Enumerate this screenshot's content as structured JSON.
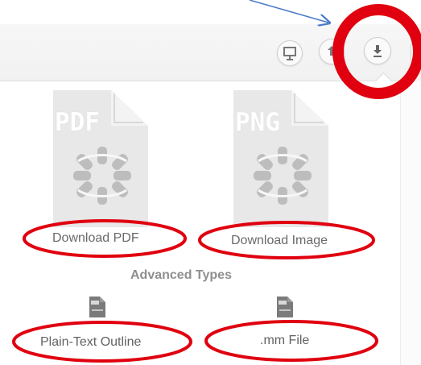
{
  "toolbar": {
    "present_icon": "presentation-icon",
    "share_icon": "share-icon",
    "download_icon": "download-icon"
  },
  "popup": {
    "pdf_badge": "PDF",
    "png_badge": "PNG",
    "download_pdf_label": "Download PDF",
    "download_image_label": "Download Image",
    "advanced_title": "Advanced Types",
    "plain_text_label": "Plain-Text Outline",
    "mm_label": ".mm File"
  },
  "annotations": {
    "color": "#e0000f",
    "arrow_color": "#4b7ac9"
  }
}
